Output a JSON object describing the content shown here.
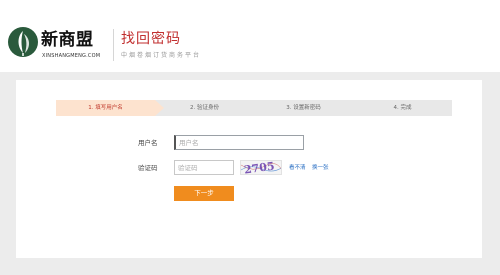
{
  "header": {
    "brand_name": "新商盟",
    "brand_subtext": "XINSHANGMENG.COM",
    "page_title": "找回密码",
    "page_subtitle": "中烟卷烟订货商务平台"
  },
  "steps": [
    {
      "label": "1. 填写用户名",
      "active": true
    },
    {
      "label": "2. 验证身份",
      "active": false
    },
    {
      "label": "3. 设置新密码",
      "active": false
    },
    {
      "label": "4. 完成",
      "active": false
    }
  ],
  "form": {
    "username_label": "用户名",
    "username_placeholder": "用户名",
    "username_value": "",
    "captcha_label": "验证码",
    "captcha_placeholder": "验证码",
    "captcha_value": "",
    "captcha_text": "2705",
    "cant_see_link": "看不清",
    "refresh_link": "换一张",
    "next_button": "下一步"
  },
  "colors": {
    "title_red": "#c12f2f",
    "step_active_bg": "#fde3cf",
    "step_bg": "#e8e8e8",
    "button_orange": "#f08c1e",
    "link_blue": "#2a6fc4",
    "page_bg": "#ececec"
  },
  "icons": {
    "logo": "leaf-logo-icon"
  }
}
